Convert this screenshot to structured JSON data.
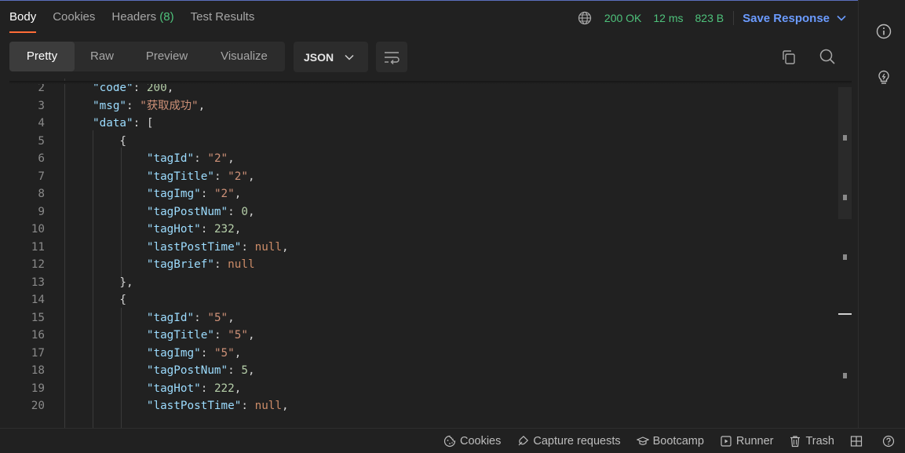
{
  "tabs": {
    "body": "Body",
    "cookies": "Cookies",
    "headers": "Headers",
    "headers_count": "(8)",
    "test_results": "Test Results"
  },
  "status": {
    "code": "200 OK",
    "time": "12 ms",
    "size": "823 B",
    "save_label": "Save Response"
  },
  "view_modes": {
    "pretty": "Pretty",
    "raw": "Raw",
    "preview": "Preview",
    "visualize": "Visualize"
  },
  "format": "JSON",
  "editor": {
    "line_numbers": [
      "2",
      "3",
      "4",
      "5",
      "6",
      "7",
      "8",
      "9",
      "10",
      "11",
      "12",
      "13",
      "14",
      "15",
      "16",
      "17",
      "18",
      "19",
      "20"
    ],
    "lines": [
      [
        {
          "t": "\"code\"",
          "c": "k"
        },
        {
          "t": ": ",
          "c": "p"
        },
        {
          "t": "200",
          "c": "n"
        },
        {
          "t": ",",
          "c": "p"
        }
      ],
      [
        {
          "t": "\"msg\"",
          "c": "k"
        },
        {
          "t": ": ",
          "c": "p"
        },
        {
          "t": "\"获取成功\"",
          "c": "s"
        },
        {
          "t": ",",
          "c": "p"
        }
      ],
      [
        {
          "t": "\"data\"",
          "c": "k"
        },
        {
          "t": ": [",
          "c": "p"
        }
      ],
      [
        {
          "t": "    {",
          "c": "p"
        }
      ],
      [
        {
          "t": "        \"tagId\"",
          "c": "k"
        },
        {
          "t": ": ",
          "c": "p"
        },
        {
          "t": "\"2\"",
          "c": "s"
        },
        {
          "t": ",",
          "c": "p"
        }
      ],
      [
        {
          "t": "        \"tagTitle\"",
          "c": "k"
        },
        {
          "t": ": ",
          "c": "p"
        },
        {
          "t": "\"2\"",
          "c": "s"
        },
        {
          "t": ",",
          "c": "p"
        }
      ],
      [
        {
          "t": "        \"tagImg\"",
          "c": "k"
        },
        {
          "t": ": ",
          "c": "p"
        },
        {
          "t": "\"2\"",
          "c": "s"
        },
        {
          "t": ",",
          "c": "p"
        }
      ],
      [
        {
          "t": "        \"tagPostNum\"",
          "c": "k"
        },
        {
          "t": ": ",
          "c": "p"
        },
        {
          "t": "0",
          "c": "n"
        },
        {
          "t": ",",
          "c": "p"
        }
      ],
      [
        {
          "t": "        \"tagHot\"",
          "c": "k"
        },
        {
          "t": ": ",
          "c": "p"
        },
        {
          "t": "232",
          "c": "n"
        },
        {
          "t": ",",
          "c": "p"
        }
      ],
      [
        {
          "t": "        \"lastPostTime\"",
          "c": "k"
        },
        {
          "t": ": ",
          "c": "p"
        },
        {
          "t": "null",
          "c": "nl"
        },
        {
          "t": ",",
          "c": "p"
        }
      ],
      [
        {
          "t": "        \"tagBrief\"",
          "c": "k"
        },
        {
          "t": ": ",
          "c": "p"
        },
        {
          "t": "null",
          "c": "nl"
        }
      ],
      [
        {
          "t": "    },",
          "c": "p"
        }
      ],
      [
        {
          "t": "    {",
          "c": "p"
        }
      ],
      [
        {
          "t": "        \"tagId\"",
          "c": "k"
        },
        {
          "t": ": ",
          "c": "p"
        },
        {
          "t": "\"5\"",
          "c": "s"
        },
        {
          "t": ",",
          "c": "p"
        }
      ],
      [
        {
          "t": "        \"tagTitle\"",
          "c": "k"
        },
        {
          "t": ": ",
          "c": "p"
        },
        {
          "t": "\"5\"",
          "c": "s"
        },
        {
          "t": ",",
          "c": "p"
        }
      ],
      [
        {
          "t": "        \"tagImg\"",
          "c": "k"
        },
        {
          "t": ": ",
          "c": "p"
        },
        {
          "t": "\"5\"",
          "c": "s"
        },
        {
          "t": ",",
          "c": "p"
        }
      ],
      [
        {
          "t": "        \"tagPostNum\"",
          "c": "k"
        },
        {
          "t": ": ",
          "c": "p"
        },
        {
          "t": "5",
          "c": "n"
        },
        {
          "t": ",",
          "c": "p"
        }
      ],
      [
        {
          "t": "        \"tagHot\"",
          "c": "k"
        },
        {
          "t": ": ",
          "c": "p"
        },
        {
          "t": "222",
          "c": "n"
        },
        {
          "t": ",",
          "c": "p"
        }
      ],
      [
        {
          "t": "        \"lastPostTime\"",
          "c": "k"
        },
        {
          "t": ": ",
          "c": "p"
        },
        {
          "t": "null",
          "c": "nl"
        },
        {
          "t": ",",
          "c": "p"
        }
      ]
    ]
  },
  "footer": {
    "cookies": "Cookies",
    "capture": "Capture requests",
    "bootcamp": "Bootcamp",
    "runner": "Runner",
    "trash": "Trash"
  },
  "colors": {
    "accent_tab": "#ff6c37",
    "status_ok": "#4ec27b",
    "save_link": "#6b9bff"
  },
  "icons": [
    "globe-icon",
    "chevron-down-icon",
    "wrap-lines-icon",
    "copy-icon",
    "search-icon",
    "info-icon",
    "lightbulb-icon",
    "cookie-icon",
    "capture-icon",
    "bootcamp-icon",
    "runner-icon",
    "trash-icon",
    "layout-icon",
    "help-icon"
  ]
}
